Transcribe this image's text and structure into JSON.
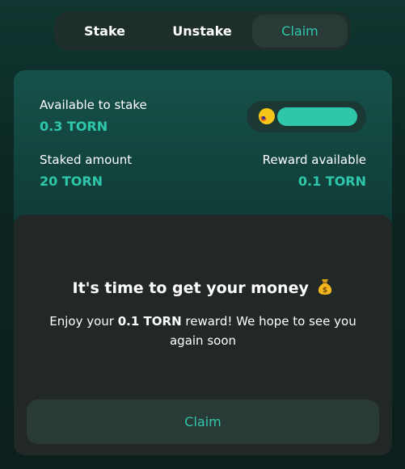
{
  "tabs": [
    {
      "label": "Stake",
      "active": false
    },
    {
      "label": "Unstake",
      "active": false
    },
    {
      "label": "Claim",
      "active": true
    }
  ],
  "stats": {
    "available_label": "Available to stake",
    "available_value": "0.3 TORN",
    "staked_label": "Staked amount",
    "staked_value": "20 TORN",
    "reward_label": "Reward available",
    "reward_value": "0.1 TORN"
  },
  "wallet": {
    "avatar_icon": "wallet-avatar-icon",
    "address_masked": true
  },
  "claim": {
    "title": "It's time to get your money",
    "title_icon": "money-bag-icon",
    "message_prefix": "Enjoy your ",
    "message_amount": "0.1 TORN",
    "message_suffix": " reward! We hope to see you again soon",
    "button_label": "Claim"
  },
  "colors": {
    "accent": "#2ec7ac",
    "background": "#0c2622",
    "panel": "#222826",
    "card": "#12433d"
  }
}
